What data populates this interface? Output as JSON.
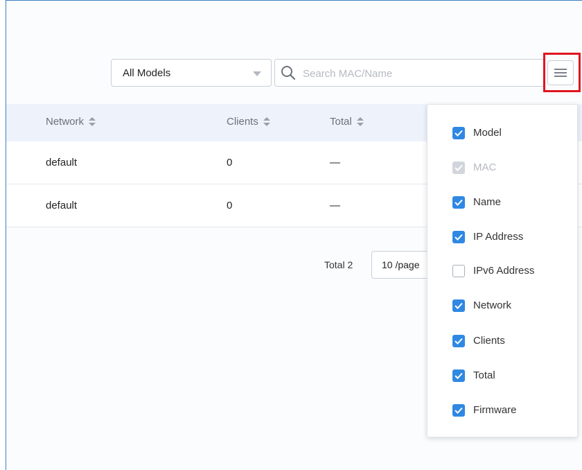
{
  "toolbar": {
    "model_filter": "All Models",
    "search_placeholder": "Search MAC/Name"
  },
  "table": {
    "columns": [
      {
        "label": "Network"
      },
      {
        "label": "Clients"
      },
      {
        "label": "Total"
      }
    ],
    "rows": [
      {
        "network": "default",
        "clients": "0",
        "total": "—"
      },
      {
        "network": "default",
        "clients": "0",
        "total": "—"
      }
    ]
  },
  "pagination": {
    "total_label": "Total 2",
    "page_size": "10 /page"
  },
  "column_menu": {
    "items": [
      {
        "label": "Model",
        "checked": true,
        "disabled": false
      },
      {
        "label": "MAC",
        "checked": true,
        "disabled": true
      },
      {
        "label": "Name",
        "checked": true,
        "disabled": false
      },
      {
        "label": "IP Address",
        "checked": true,
        "disabled": false
      },
      {
        "label": "IPv6 Address",
        "checked": false,
        "disabled": false
      },
      {
        "label": "Network",
        "checked": true,
        "disabled": false
      },
      {
        "label": "Clients",
        "checked": true,
        "disabled": false
      },
      {
        "label": "Total",
        "checked": true,
        "disabled": false
      },
      {
        "label": "Firmware",
        "checked": true,
        "disabled": false
      }
    ]
  },
  "colors": {
    "accent": "#2f88e2",
    "highlight": "#e0141e",
    "header_bg": "#eef3fb"
  },
  "icons": {
    "search": "search-icon",
    "menu": "hamburger-icon",
    "sort": "sort-icon",
    "dropdown": "caret-down-icon",
    "check": "check-icon"
  }
}
